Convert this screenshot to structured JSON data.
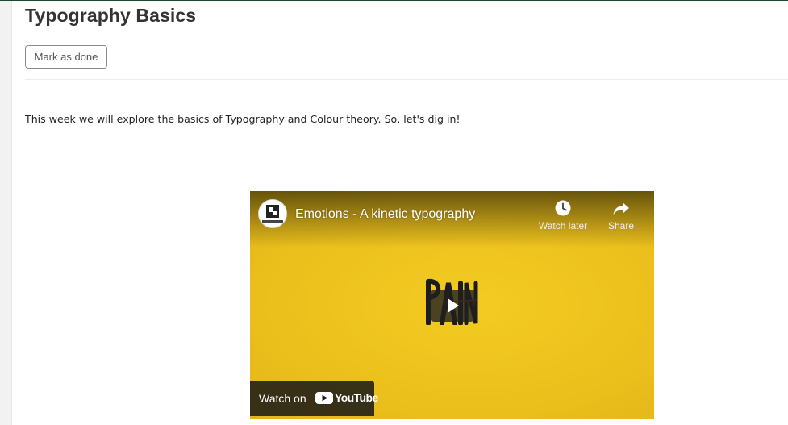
{
  "page": {
    "title": "Typography Basics",
    "mark_done_label": "Mark as done",
    "intro_text": "This week we will explore the basics of Typography and Colour theory. So, let's dig in!"
  },
  "video": {
    "title": "Emotions - A kinetic typography",
    "watch_later_label": "Watch later",
    "share_label": "Share",
    "watch_on_label": "Watch on",
    "youtube_wordmark": "YouTube",
    "channel_avatar_icon": "pixelcatch-logo-icon",
    "video_background_color": "#efc41d",
    "art_text": "PAIN"
  },
  "colors": {
    "title_text": "#333333",
    "button_border": "#8a8a8a",
    "top_border": "#1a4a2e",
    "youtube_red": "#ff0000"
  }
}
